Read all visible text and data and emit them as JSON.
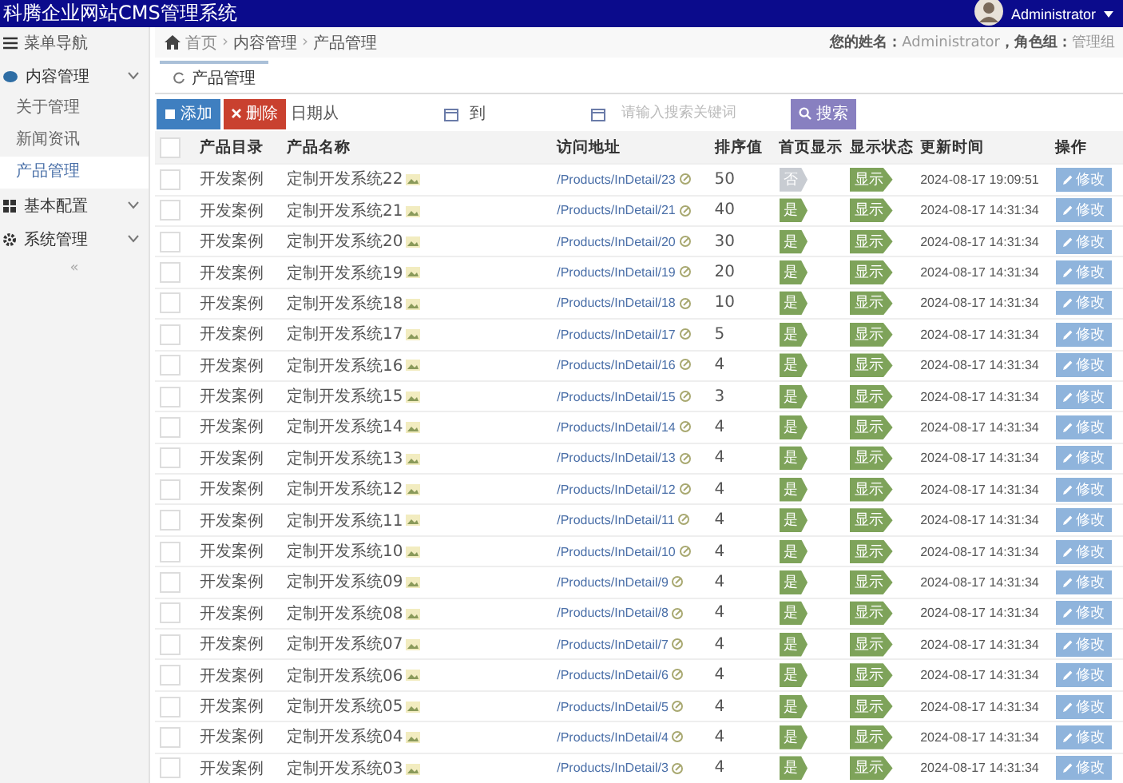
{
  "header": {
    "title": "科腾企业网站CMS管理系统",
    "user": "Administrator"
  },
  "sidebar": {
    "title": "菜单导航",
    "items": [
      {
        "label": "内容管理",
        "kind": "content",
        "children": [
          {
            "label": "关于管理",
            "selected": false
          },
          {
            "label": "新闻资讯",
            "selected": false
          },
          {
            "label": "产品管理",
            "selected": true
          }
        ]
      },
      {
        "label": "基本配置",
        "kind": "grid"
      },
      {
        "label": "系统管理",
        "kind": "gear"
      }
    ],
    "collapse": "«"
  },
  "breadcrumb": {
    "items": [
      "首页",
      "内容管理",
      "产品管理"
    ],
    "separator": "›"
  },
  "user_info": {
    "name_label": "您的姓名：",
    "name": "Administrator",
    "role_label": "，角色组：",
    "role": "管理组"
  },
  "tabs": [
    {
      "label": "产品管理",
      "selected": true
    }
  ],
  "toolbar": {
    "add": "添加",
    "delete": "删除",
    "date_from": "日期从",
    "date_to": "到",
    "search_placeholder": "请输入搜索关键词",
    "search": "搜索"
  },
  "table": {
    "select_all_checked": false,
    "columns": [
      "产品目录",
      "产品名称",
      "访问地址",
      "排序值",
      "首页显示",
      "显示状态",
      "更新时间",
      "操作"
    ],
    "rows": [
      {
        "checked": false,
        "category": "开发案例",
        "name": "定制开发系统22",
        "url": "/Products/InDetail/23",
        "sort": "50",
        "home": {
          "text": "否",
          "on": false
        },
        "status": {
          "text": "显示",
          "on": true
        },
        "updated": "2024-08-17 19:09:51",
        "action": "修改"
      },
      {
        "checked": false,
        "category": "开发案例",
        "name": "定制开发系统21",
        "url": "/Products/InDetail/21",
        "sort": "40",
        "home": {
          "text": "是",
          "on": true
        },
        "status": {
          "text": "显示",
          "on": true
        },
        "updated": "2024-08-17 14:31:34",
        "action": "修改"
      },
      {
        "checked": false,
        "category": "开发案例",
        "name": "定制开发系统20",
        "url": "/Products/InDetail/20",
        "sort": "30",
        "home": {
          "text": "是",
          "on": true
        },
        "status": {
          "text": "显示",
          "on": true
        },
        "updated": "2024-08-17 14:31:34",
        "action": "修改"
      },
      {
        "checked": false,
        "category": "开发案例",
        "name": "定制开发系统19",
        "url": "/Products/InDetail/19",
        "sort": "20",
        "home": {
          "text": "是",
          "on": true
        },
        "status": {
          "text": "显示",
          "on": true
        },
        "updated": "2024-08-17 14:31:34",
        "action": "修改"
      },
      {
        "checked": false,
        "category": "开发案例",
        "name": "定制开发系统18",
        "url": "/Products/InDetail/18",
        "sort": "10",
        "home": {
          "text": "是",
          "on": true
        },
        "status": {
          "text": "显示",
          "on": true
        },
        "updated": "2024-08-17 14:31:34",
        "action": "修改"
      },
      {
        "checked": false,
        "category": "开发案例",
        "name": "定制开发系统17",
        "url": "/Products/InDetail/17",
        "sort": "5",
        "home": {
          "text": "是",
          "on": true
        },
        "status": {
          "text": "显示",
          "on": true
        },
        "updated": "2024-08-17 14:31:34",
        "action": "修改"
      },
      {
        "checked": false,
        "category": "开发案例",
        "name": "定制开发系统16",
        "url": "/Products/InDetail/16",
        "sort": "4",
        "home": {
          "text": "是",
          "on": true
        },
        "status": {
          "text": "显示",
          "on": true
        },
        "updated": "2024-08-17 14:31:34",
        "action": "修改"
      },
      {
        "checked": false,
        "category": "开发案例",
        "name": "定制开发系统15",
        "url": "/Products/InDetail/15",
        "sort": "3",
        "home": {
          "text": "是",
          "on": true
        },
        "status": {
          "text": "显示",
          "on": true
        },
        "updated": "2024-08-17 14:31:34",
        "action": "修改"
      },
      {
        "checked": false,
        "category": "开发案例",
        "name": "定制开发系统14",
        "url": "/Products/InDetail/14",
        "sort": "4",
        "home": {
          "text": "是",
          "on": true
        },
        "status": {
          "text": "显示",
          "on": true
        },
        "updated": "2024-08-17 14:31:34",
        "action": "修改"
      },
      {
        "checked": false,
        "category": "开发案例",
        "name": "定制开发系统13",
        "url": "/Products/InDetail/13",
        "sort": "4",
        "home": {
          "text": "是",
          "on": true
        },
        "status": {
          "text": "显示",
          "on": true
        },
        "updated": "2024-08-17 14:31:34",
        "action": "修改"
      },
      {
        "checked": false,
        "category": "开发案例",
        "name": "定制开发系统12",
        "url": "/Products/InDetail/12",
        "sort": "4",
        "home": {
          "text": "是",
          "on": true
        },
        "status": {
          "text": "显示",
          "on": true
        },
        "updated": "2024-08-17 14:31:34",
        "action": "修改"
      },
      {
        "checked": false,
        "category": "开发案例",
        "name": "定制开发系统11",
        "url": "/Products/InDetail/11",
        "sort": "4",
        "home": {
          "text": "是",
          "on": true
        },
        "status": {
          "text": "显示",
          "on": true
        },
        "updated": "2024-08-17 14:31:34",
        "action": "修改"
      },
      {
        "checked": false,
        "category": "开发案例",
        "name": "定制开发系统10",
        "url": "/Products/InDetail/10",
        "sort": "4",
        "home": {
          "text": "是",
          "on": true
        },
        "status": {
          "text": "显示",
          "on": true
        },
        "updated": "2024-08-17 14:31:34",
        "action": "修改"
      },
      {
        "checked": false,
        "category": "开发案例",
        "name": "定制开发系统09",
        "url": "/Products/InDetail/9",
        "sort": "4",
        "home": {
          "text": "是",
          "on": true
        },
        "status": {
          "text": "显示",
          "on": true
        },
        "updated": "2024-08-17 14:31:34",
        "action": "修改"
      },
      {
        "checked": false,
        "category": "开发案例",
        "name": "定制开发系统08",
        "url": "/Products/InDetail/8",
        "sort": "4",
        "home": {
          "text": "是",
          "on": true
        },
        "status": {
          "text": "显示",
          "on": true
        },
        "updated": "2024-08-17 14:31:34",
        "action": "修改"
      },
      {
        "checked": false,
        "category": "开发案例",
        "name": "定制开发系统07",
        "url": "/Products/InDetail/7",
        "sort": "4",
        "home": {
          "text": "是",
          "on": true
        },
        "status": {
          "text": "显示",
          "on": true
        },
        "updated": "2024-08-17 14:31:34",
        "action": "修改"
      },
      {
        "checked": false,
        "category": "开发案例",
        "name": "定制开发系统06",
        "url": "/Products/InDetail/6",
        "sort": "4",
        "home": {
          "text": "是",
          "on": true
        },
        "status": {
          "text": "显示",
          "on": true
        },
        "updated": "2024-08-17 14:31:34",
        "action": "修改"
      },
      {
        "checked": false,
        "category": "开发案例",
        "name": "定制开发系统05",
        "url": "/Products/InDetail/5",
        "sort": "4",
        "home": {
          "text": "是",
          "on": true
        },
        "status": {
          "text": "显示",
          "on": true
        },
        "updated": "2024-08-17 14:31:34",
        "action": "修改"
      },
      {
        "checked": false,
        "category": "开发案例",
        "name": "定制开发系统04",
        "url": "/Products/InDetail/4",
        "sort": "4",
        "home": {
          "text": "是",
          "on": true
        },
        "status": {
          "text": "显示",
          "on": true
        },
        "updated": "2024-08-17 14:31:34",
        "action": "修改"
      },
      {
        "checked": false,
        "category": "开发案例",
        "name": "定制开发系统03",
        "url": "/Products/InDetail/3",
        "sort": "4",
        "home": {
          "text": "是",
          "on": true
        },
        "status": {
          "text": "显示",
          "on": true
        },
        "updated": "2024-08-17 14:31:34",
        "action": "修改"
      }
    ]
  }
}
